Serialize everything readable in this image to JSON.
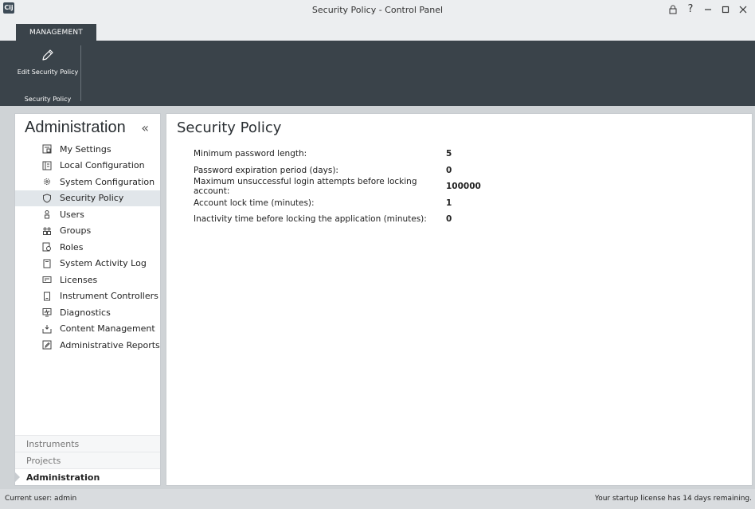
{
  "window": {
    "app_logo": "Cij",
    "title": "Security Policy - Control Panel",
    "controls": [
      "lock-icon",
      "help-icon",
      "minimize-icon",
      "maximize-icon",
      "close-icon"
    ]
  },
  "ribbon": {
    "tab_label": "MANAGEMENT",
    "button_label": "Edit Security Policy",
    "group_label": "Security Policy",
    "bg_color": "#3a434a"
  },
  "sidebar": {
    "title": "Administration",
    "collapse_glyph": "«",
    "items": [
      {
        "label": "My Settings",
        "icon": "settings-doc-icon"
      },
      {
        "label": "Local Configuration",
        "icon": "local-config-icon"
      },
      {
        "label": "System Configuration",
        "icon": "system-config-icon"
      },
      {
        "label": "Security Policy",
        "icon": "shield-icon",
        "selected": true
      },
      {
        "label": "Users",
        "icon": "user-icon"
      },
      {
        "label": "Groups",
        "icon": "groups-icon"
      },
      {
        "label": "Roles",
        "icon": "roles-icon"
      },
      {
        "label": "System Activity Log",
        "icon": "log-icon"
      },
      {
        "label": "Licenses",
        "icon": "license-icon"
      },
      {
        "label": "Instrument Controllers",
        "icon": "instrument-controller-icon"
      },
      {
        "label": "Diagnostics",
        "icon": "diagnostics-icon"
      },
      {
        "label": "Content Management",
        "icon": "content-management-icon"
      },
      {
        "label": "Administrative Reports",
        "icon": "reports-icon"
      }
    ],
    "nav": [
      {
        "label": "Instruments"
      },
      {
        "label": "Projects"
      },
      {
        "label": "Administration",
        "active": true
      }
    ]
  },
  "main": {
    "title": "Security Policy",
    "rows": [
      {
        "label": "Minimum password length:",
        "value": "5"
      },
      {
        "label": "Password expiration period (days):",
        "value": "0"
      },
      {
        "label": "Maximum unsuccessful login attempts before locking account:",
        "value": "100000"
      },
      {
        "label": "Account lock time (minutes):",
        "value": "1"
      },
      {
        "label": "Inactivity time before locking the application (minutes):",
        "value": "0"
      }
    ]
  },
  "status": {
    "user": "Current user: admin",
    "license": "Your startup license has 14 days remaining."
  }
}
